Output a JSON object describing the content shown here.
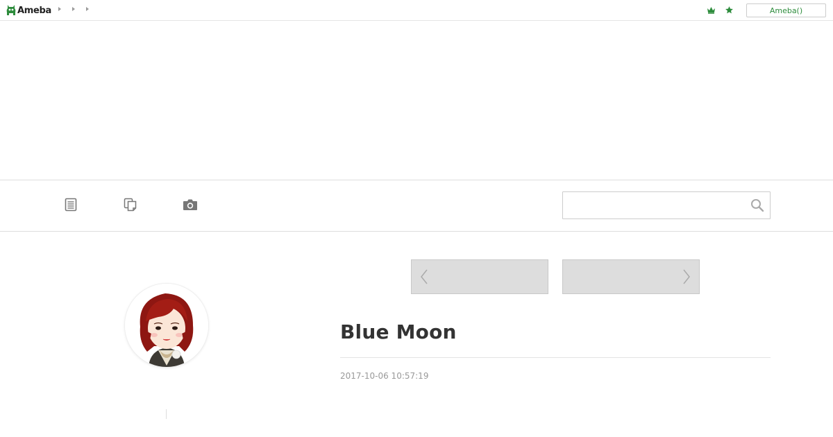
{
  "header": {
    "logo_text": "Ameba",
    "breadcrumbs": [
      "",
      "",
      ""
    ],
    "ameba_button_label": "Ameba()",
    "accent_color": "#2d8c3c"
  },
  "nav": {
    "icons": [
      "entry-list-icon",
      "theme-list-icon",
      "camera-icon"
    ],
    "search": {
      "value": "",
      "placeholder": ""
    }
  },
  "pager": {
    "prev_label": "",
    "next_label": ""
  },
  "article": {
    "title": "Blue Moon",
    "date": "2017-10-06 10:57:19"
  }
}
